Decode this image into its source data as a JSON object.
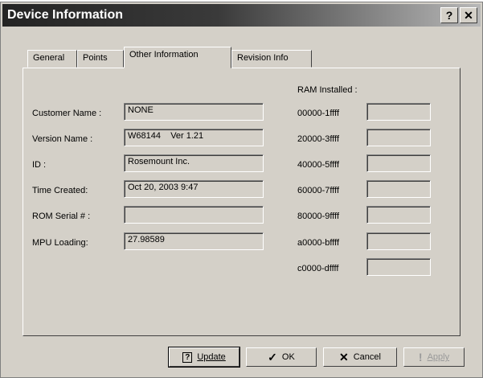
{
  "window": {
    "title": "Device Information",
    "help_glyph": "?",
    "close_glyph": "✕"
  },
  "tabs": [
    {
      "label": "General"
    },
    {
      "label": "Points"
    },
    {
      "label": "Other Information",
      "active": true
    },
    {
      "label": "Revision Info"
    }
  ],
  "left_fields": [
    {
      "label": "Customer Name :",
      "value": "NONE"
    },
    {
      "label": "Version Name :",
      "value": "W68144    Ver 1.21"
    },
    {
      "label": "ID :",
      "value": "Rosemount Inc."
    },
    {
      "label": "Time Created:",
      "value": "Oct 20, 2003  9:47"
    },
    {
      "label": "ROM Serial # :",
      "value": ""
    },
    {
      "label": "MPU Loading:",
      "value": "27.98589"
    }
  ],
  "ram": {
    "heading": "RAM Installed :",
    "rows": [
      {
        "label": "00000-1ffff",
        "value": ""
      },
      {
        "label": "20000-3ffff",
        "value": ""
      },
      {
        "label": "40000-5ffff",
        "value": ""
      },
      {
        "label": "60000-7ffff",
        "value": ""
      },
      {
        "label": "80000-9ffff",
        "value": ""
      },
      {
        "label": "a0000-bffff",
        "value": ""
      },
      {
        "label": "c0000-dffff",
        "value": ""
      }
    ]
  },
  "buttons": {
    "update": {
      "icon": "?",
      "label": "Update"
    },
    "ok": {
      "icon": "✓",
      "label": "OK"
    },
    "cancel": {
      "icon": "✕",
      "label": "Cancel"
    },
    "apply": {
      "icon": "!",
      "label": "Apply"
    }
  }
}
